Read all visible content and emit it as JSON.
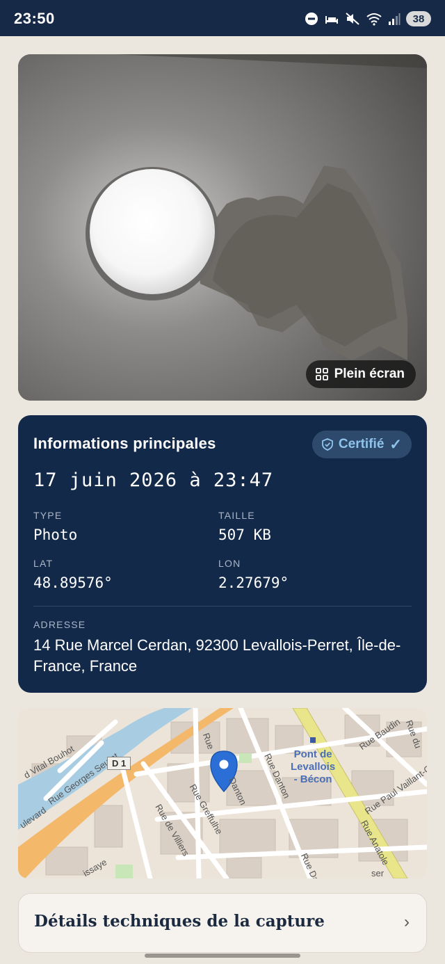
{
  "status_bar": {
    "time": "23:50",
    "battery": "38",
    "icons": [
      "dnd-icon",
      "sleep-icon",
      "mute-icon",
      "wifi-icon",
      "signal-icon"
    ]
  },
  "photo": {
    "fullscreen_label": "Plein écran"
  },
  "info": {
    "title": "Informations principales",
    "badge": "Certifié",
    "badge_check": "✓",
    "datetime": "17 juin 2026 à 23:47",
    "type_label": "TYPE",
    "type_value": "Photo",
    "size_label": "TAILLE",
    "size_value": "507 KB",
    "lat_label": "LAT",
    "lat_value": "48.89576°",
    "lon_label": "LON",
    "lon_value": "2.27679°",
    "address_label": "ADRESSE",
    "address_value": "14 Rue Marcel Cerdan, 92300 Levallois-Perret, Île-de-France, France"
  },
  "map": {
    "labels": {
      "vital_bouhot": "d Vital Bouhot",
      "georges_seurat": "Rue Georges Seurat",
      "boulevard": "ulevard",
      "d1": "D 1",
      "rue_vertical": "Rue",
      "rue_greffulhe": "Rue Greffulhe",
      "rue_de_villiers": "Rue de Villiers",
      "rue_danton": "Rue Danton",
      "danton": "Danton",
      "station": "Pont de\nLevallois\n- Bécon",
      "rue_baudin": "Rue Baudin",
      "rue_du": "Rue du",
      "rue_paul_vaillant": "Rue Paul Vaillant-C",
      "rue_anatole": "Rue Anatole",
      "rue_da": "Rue Da",
      "issaye": "issaye",
      "ser": "ser"
    },
    "colors": {
      "river": "#a8cde3",
      "major_road": "#f3b86a",
      "rail_road": "#e8e58a",
      "buildings": "#d9cfc4",
      "pin": "#2b6fd6"
    }
  },
  "details": {
    "label": "Détails techniques de la capture",
    "chevron": "›"
  }
}
